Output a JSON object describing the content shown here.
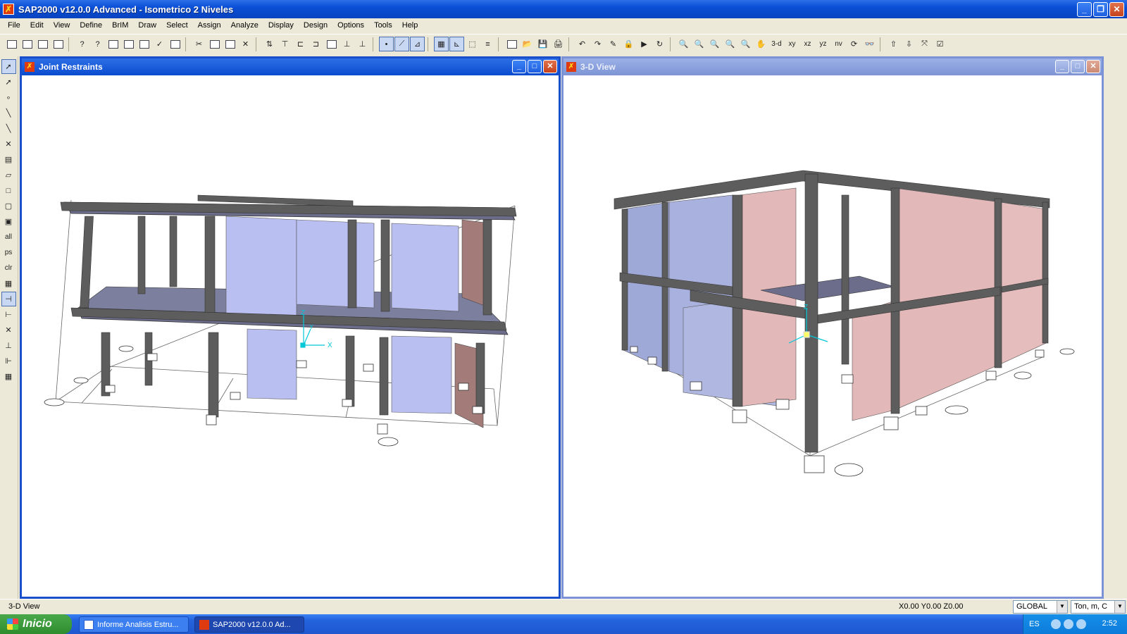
{
  "app": {
    "title": "SAP2000 v12.0.0 Advanced  - Isometrico 2 Niveles",
    "icon": "sap2000-app-icon"
  },
  "menu": [
    "File",
    "Edit",
    "View",
    "Define",
    "BrIM",
    "Draw",
    "Select",
    "Assign",
    "Analyze",
    "Display",
    "Design",
    "Options",
    "Tools",
    "Help"
  ],
  "toolbar": {
    "view_labels": [
      "3-d",
      "xy",
      "xz",
      "yz",
      "nv"
    ]
  },
  "left_toolbar": {
    "select_labels": [
      "all",
      "ps",
      "clr"
    ]
  },
  "windows": {
    "left": {
      "title": "Joint Restraints"
    },
    "right": {
      "title": "3-D View"
    }
  },
  "axes": {
    "x": "X",
    "y": "Y",
    "z": "Z"
  },
  "status": {
    "view": "3-D View",
    "coords": "X0.00  Y0.00  Z0.00",
    "coord_system": "GLOBAL",
    "units": "Ton, m, C"
  },
  "taskbar": {
    "start": "Inicio",
    "tasks": [
      "Informe Analisis Estru...",
      "SAP2000 v12.0.0 Ad..."
    ],
    "lang": "ES",
    "clock": "2:52"
  },
  "colors": {
    "frame": "#5d5d5d",
    "wall_blue": "#b9bff0",
    "wall_pink": "#e3b8b8",
    "slab": "#6b6d8a",
    "xp_blue": "#0a4fd6"
  }
}
